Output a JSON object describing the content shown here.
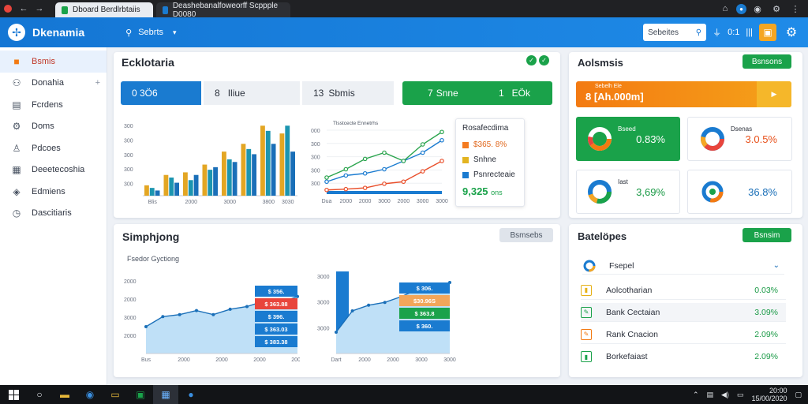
{
  "browser": {
    "tabs": [
      {
        "title": "Dboard Berdlrbtaiis"
      },
      {
        "title": "Deashebanalfoweorff Scppple D0080"
      }
    ]
  },
  "app": {
    "brand": "Dkenamia",
    "search_label": "Sebrts",
    "search_box": "Sebeites",
    "header_time": "0:1"
  },
  "sidebar": {
    "items": [
      {
        "label": "Bsmis",
        "icon": "briefcase-icon"
      },
      {
        "label": "Donahia",
        "icon": "user-icon"
      },
      {
        "label": "Fcrdens",
        "icon": "document-icon"
      },
      {
        "label": "Doms",
        "icon": "gear-icon"
      },
      {
        "label": "Pdcoes",
        "icon": "person-icon"
      },
      {
        "label": "Deeetecoshia",
        "icon": "calendar-icon"
      },
      {
        "label": "Edmiens",
        "icon": "chart-icon"
      },
      {
        "label": "Dascitiaris",
        "icon": "clock-icon"
      }
    ]
  },
  "overview": {
    "title": "Ecklotaria",
    "kpis": [
      {
        "value": "0 3Ö6",
        "sub": ""
      },
      {
        "value": "8",
        "sub": "Iliue"
      },
      {
        "value": "13",
        "sub": "Sbmis"
      },
      {
        "value": "7",
        "sub": "Snne"
      },
      {
        "value": "1",
        "sub": "EÖk"
      }
    ],
    "legend": {
      "title": "Rosafecdima",
      "rows": [
        {
          "label": "$365. 8%",
          "color": "#f47b20"
        },
        {
          "label": "Snhne",
          "color": "#e3b421"
        },
        {
          "label": "Psnrecteaie",
          "color": "#1a7bd0"
        }
      ],
      "total": "9,325",
      "total_sub": "ons"
    }
  },
  "analysis": {
    "title": "Aolsmsis",
    "button": "Bsnsons",
    "orange_small": "Sebelh Ele",
    "orange_value": "8 [Ah.000m]",
    "tiles": [
      {
        "label": "Bseed",
        "value": "0.83%"
      },
      {
        "label": "Dsenas",
        "value": "3.0.5%"
      },
      {
        "label": "Iast",
        "value": "3,69%"
      },
      {
        "label": "",
        "value": "36.8%"
      }
    ]
  },
  "simphjong": {
    "title": "Simphjong",
    "button": "Bsmsebs",
    "chart_label": "Fsedor Gyctiong"
  },
  "batelopes": {
    "title": "Batelöpes",
    "button": "Bsnsim",
    "header_row": "Fsepel",
    "rows": [
      {
        "label": "Aolcotharian",
        "value": "0.03%",
        "color": "#e6b117"
      },
      {
        "label": "Bank Cectaian",
        "value": "3.09%",
        "color": "#1aa24a"
      },
      {
        "label": "Rank Cnacion",
        "value": "2.09%",
        "color": "#f37a12"
      },
      {
        "label": "Borkefaiast",
        "value": "2.09%",
        "color": "#1aa24a"
      }
    ]
  },
  "taskbar": {
    "time": "20:00",
    "date": "15/00/2020"
  },
  "chart_data": [
    {
      "type": "bar",
      "categories": [
        "Blis",
        "2008",
        "2000",
        "2000",
        "3000",
        "3080",
        "3800",
        "3030"
      ],
      "series": [
        {
          "values": [
            200,
            400,
            450,
            600,
            850,
            1000,
            1350,
            1200
          ]
        },
        {
          "values": [
            150,
            350,
            300,
            500,
            700,
            900,
            1250,
            1350
          ]
        },
        {
          "values": [
            100,
            250,
            400,
            550,
            650,
            800,
            1000,
            850
          ]
        }
      ],
      "ylim": [
        0,
        1400
      ],
      "y_ticks": [
        "300",
        "300",
        "300",
        "300",
        "300"
      ],
      "colors": [
        "#e3a623",
        "#1c95b0",
        "#1a6fb8"
      ]
    },
    {
      "type": "line",
      "title": "Tlsstcecte Ennetrhs",
      "categories": [
        "Dua",
        "2000",
        "2000",
        "3000",
        "2000",
        "3000",
        "3000"
      ],
      "series": [
        {
          "values": [
            30,
            45,
            50,
            60,
            80,
            100,
            130
          ]
        },
        {
          "values": [
            40,
            60,
            85,
            100,
            80,
            120,
            150
          ]
        },
        {
          "values": [
            10,
            12,
            15,
            25,
            30,
            55,
            80
          ]
        }
      ],
      "ylim": [
        0,
        160
      ],
      "y_ticks": [
        "300",
        "300",
        "300",
        "300",
        "000"
      ],
      "colors": [
        "#1a7bd0",
        "#2aa44d",
        "#e94e2a"
      ]
    },
    {
      "type": "area",
      "categories": [
        "Bus",
        "2000",
        "2000",
        "2000",
        "2000"
      ],
      "values": [
        40,
        55,
        58,
        64,
        58,
        66,
        70,
        78,
        76,
        85
      ],
      "ylim": [
        0,
        120
      ],
      "y_ticks": [
        "2000",
        "2000",
        "3000",
        "2000"
      ],
      "tags": [
        "$ 356.",
        "$ 363.88",
        "$ 396.",
        "$ 363.03",
        "$ 383.38"
      ]
    },
    {
      "type": "area",
      "categories": [
        "Dart",
        "2000",
        "2000",
        "3000",
        "3000"
      ],
      "values": [
        30,
        60,
        68,
        72,
        80,
        90,
        95,
        100
      ],
      "ylim": [
        0,
        120
      ],
      "y_ticks": [
        "3000",
        "3000",
        "3000"
      ],
      "tags": [
        "$ 306.",
        "$30.96S",
        "$ 363.8",
        "$ 360."
      ]
    }
  ]
}
